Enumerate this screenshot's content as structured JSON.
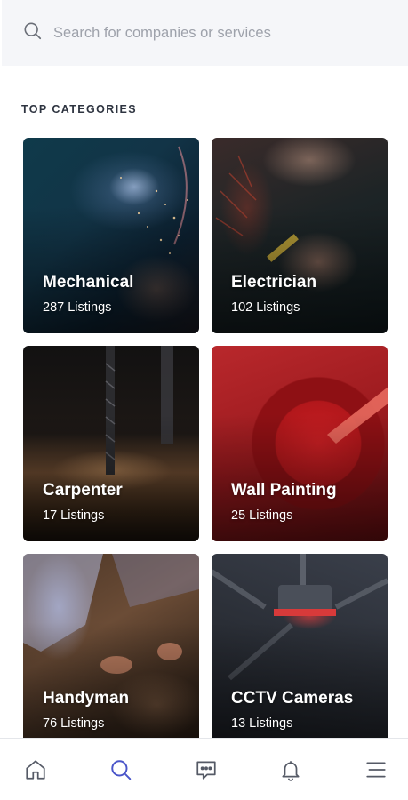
{
  "search": {
    "placeholder": "Search for companies or services"
  },
  "section": {
    "title": "TOP CATEGORIES"
  },
  "categories": [
    {
      "name": "Mechanical",
      "count": "287 Listings"
    },
    {
      "name": "Electrician",
      "count": "102 Listings"
    },
    {
      "name": "Carpenter",
      "count": "17 Listings"
    },
    {
      "name": "Wall Painting",
      "count": "25 Listings"
    },
    {
      "name": "Handyman",
      "count": "76 Listings"
    },
    {
      "name": "CCTV Cameras",
      "count": "13 Listings"
    }
  ],
  "nav": {
    "items": [
      "home-icon",
      "search-icon",
      "chat-icon",
      "bell-icon",
      "menu-icon"
    ],
    "active": "search-icon",
    "active_color": "#4a55c9",
    "inactive_color": "#555a66"
  }
}
